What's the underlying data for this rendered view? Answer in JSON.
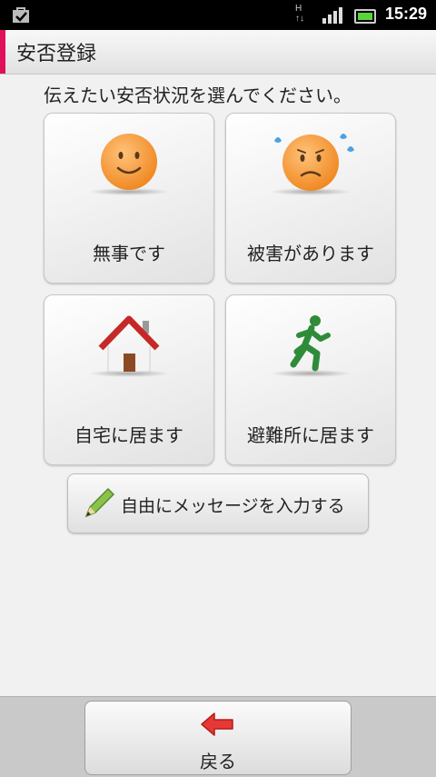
{
  "status_bar": {
    "time": "15:29",
    "network": "H",
    "icons": [
      "bag-check-icon",
      "network-h-icon",
      "signal-icon",
      "battery-icon"
    ]
  },
  "header": {
    "title": "安否登録",
    "accent_color": "#e0105a"
  },
  "instruction": "伝えたい安否状況を選んでください。",
  "options": [
    {
      "label": "無事です",
      "icon": "smile-face-icon"
    },
    {
      "label": "被害があります",
      "icon": "worried-face-icon"
    },
    {
      "label": "自宅に居ます",
      "icon": "house-icon"
    },
    {
      "label": "避難所に居ます",
      "icon": "running-person-icon"
    }
  ],
  "message_button": {
    "label": "自由にメッセージを入力する",
    "icon": "pencil-icon"
  },
  "back_button": {
    "label": "戻る",
    "icon": "back-arrow-icon"
  }
}
